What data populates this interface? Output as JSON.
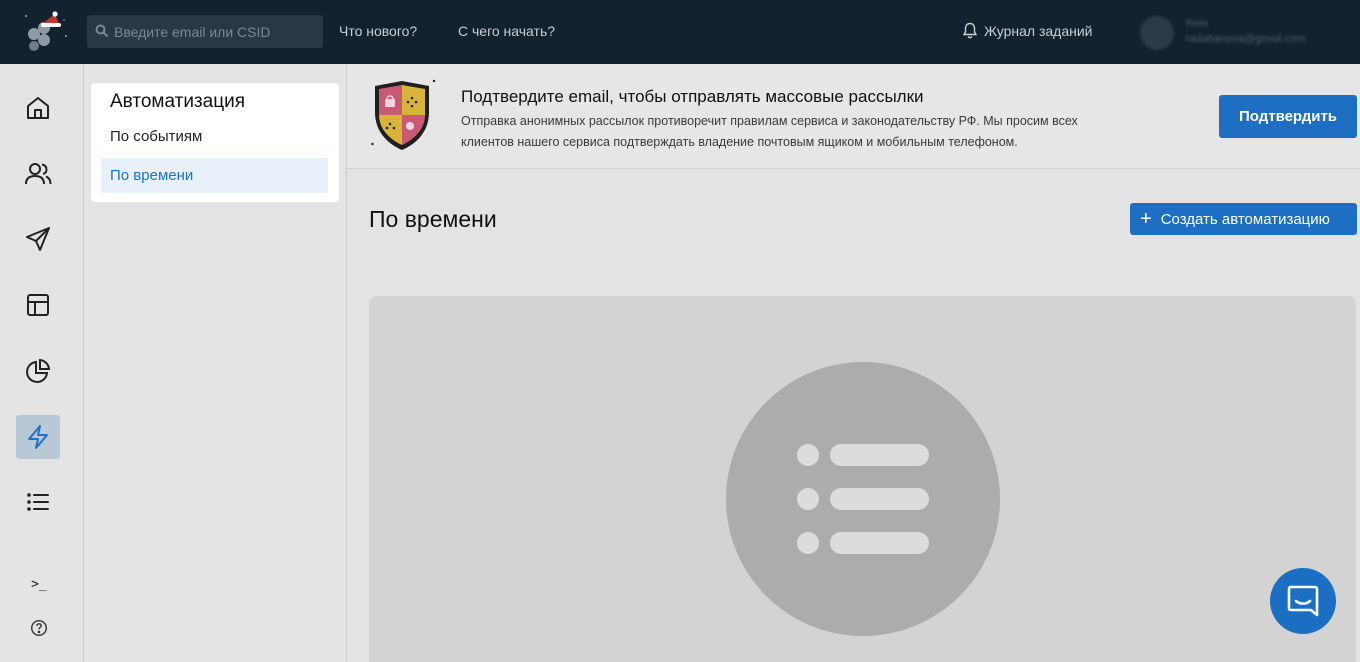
{
  "topbar": {
    "search_placeholder": "Введите email или CSID",
    "whats_new": "Что нового?",
    "getting_started": "С чего начать?",
    "journal": "Журнал заданий",
    "user_name": "Rada",
    "user_email": "radabanova@gmail.com"
  },
  "rail": {
    "items": [
      {
        "icon": "home-icon",
        "active": false
      },
      {
        "icon": "users-icon",
        "active": false
      },
      {
        "icon": "send-icon",
        "active": false
      },
      {
        "icon": "layout-icon",
        "active": false
      },
      {
        "icon": "pie-chart-icon",
        "active": false
      },
      {
        "icon": "lightning-icon",
        "active": true
      },
      {
        "icon": "list-icon",
        "active": false
      }
    ],
    "bottom": [
      {
        "icon": "terminal-icon",
        "text": ">_"
      },
      {
        "icon": "help-icon"
      }
    ]
  },
  "submenu": {
    "title": "Автоматизация",
    "items": [
      {
        "label": "По событиям",
        "active": false
      },
      {
        "label": "По времени",
        "active": true
      }
    ]
  },
  "banner": {
    "title": "Подтвердите email, чтобы отправлять массовые рассылки",
    "text_line1": "Отправка анонимных рассылок противоречит правилам сервиса и законодательству РФ. Мы просим всех",
    "text_line2": "клиентов нашего сервиса подтверждать владение почтовым ящиком и мобильным телефоном.",
    "confirm_label": "Подтвердить"
  },
  "main": {
    "title": "По времени",
    "create_label": "Создать автоматизацию",
    "empty_icon": "list-icon"
  },
  "colors": {
    "topbar": "#142230",
    "accent": "#1c6fc2",
    "active_rail": "#b9c8d6",
    "active_link": "#1a73c8"
  }
}
